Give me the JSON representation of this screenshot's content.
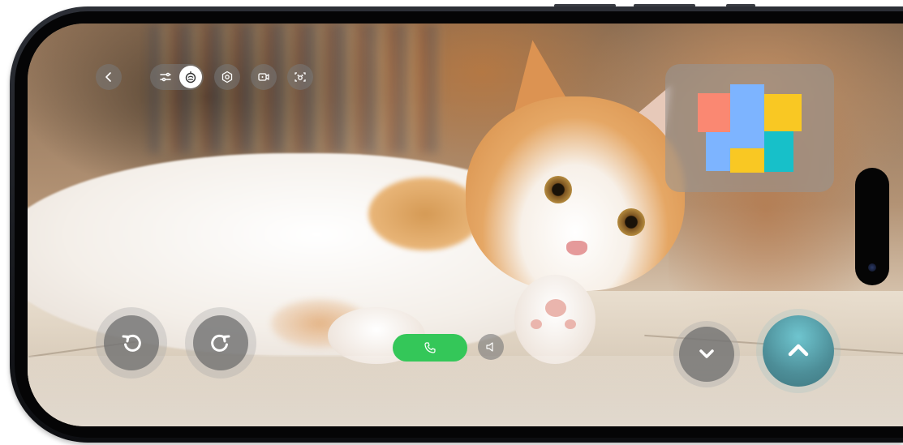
{
  "toolbar": {
    "back": {
      "icon": "chevron-left-icon"
    },
    "mode_toggle": {
      "left_icon": "sliders-icon",
      "right_icon": "robot-face-icon",
      "selected": "right"
    },
    "buttons": [
      {
        "icon": "settings-hexagon-icon"
      },
      {
        "icon": "video-record-icon"
      },
      {
        "icon": "pet-scan-icon"
      }
    ]
  },
  "minimap": {
    "rooms": [
      {
        "name": "room-salmon",
        "color": "#fa8872"
      },
      {
        "name": "room-blue-main",
        "color": "#7db4ff"
      },
      {
        "name": "room-yellow-top",
        "color": "#f9c823"
      },
      {
        "name": "room-blue-lower",
        "color": "#7db4ff"
      },
      {
        "name": "room-yellow-bottom",
        "color": "#f9c823"
      },
      {
        "name": "room-teal",
        "color": "#17c0c9"
      }
    ]
  },
  "controls": {
    "rotate_left": {
      "icon": "rotate-ccw-icon"
    },
    "rotate_right": {
      "icon": "rotate-cw-icon"
    },
    "call": {
      "icon": "phone-icon",
      "color": "#34c759"
    },
    "speaker": {
      "icon": "speaker-icon"
    },
    "down": {
      "icon": "chevron-down-icon"
    },
    "up": {
      "icon": "chevron-up-icon",
      "color": "#5aa7b1"
    }
  },
  "colors": {
    "overlay_button": "#787878",
    "frame": "#1c1e22"
  }
}
